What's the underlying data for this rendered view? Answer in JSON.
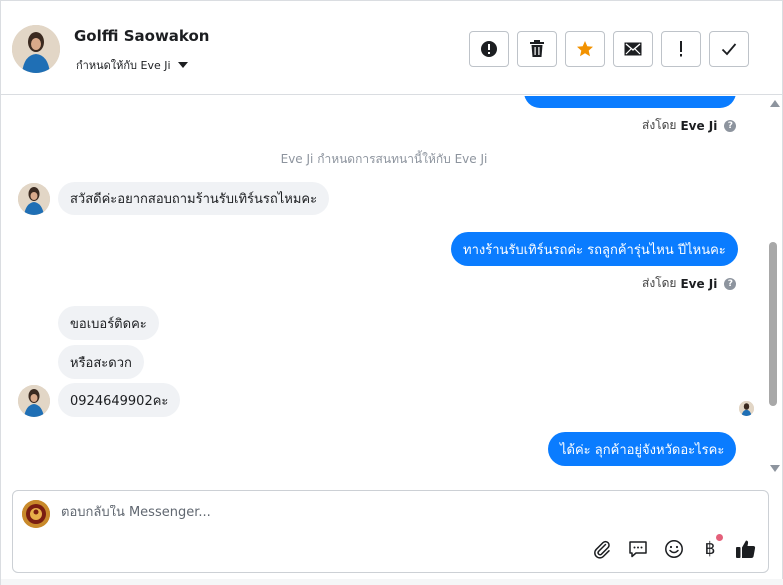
{
  "header": {
    "contact_name": "Golffi Saowakon",
    "assign_label": "กำหนดให้กับ Eve Ji",
    "actions": [
      {
        "name": "spam-button",
        "icon": "alert-circle-icon"
      },
      {
        "name": "delete-button",
        "icon": "trash-icon"
      },
      {
        "name": "star-button",
        "icon": "star-icon"
      },
      {
        "name": "mark-unread-button",
        "icon": "envelope-icon"
      },
      {
        "name": "follow-up-button",
        "icon": "exclamation-icon"
      },
      {
        "name": "mark-done-button",
        "icon": "checkmark-icon"
      }
    ],
    "star_color": "#f29200"
  },
  "conversation": {
    "sent_by_prefix": "ส่งโดย",
    "sent_by_name": "Eve Ji",
    "system_note": "Eve Ji กำหนดการสนทนานี้ให้กับ Eve Ji",
    "messages": [
      {
        "direction": "in",
        "text": "สวัสดีค่ะอยากสอบถามร้านรับเทิร์นรถไหมคะ"
      },
      {
        "direction": "out",
        "text": "ทางร้านรับเทิร์นรถค่ะ รถลูกค้ารุ่นไหน ปีไหนคะ"
      },
      {
        "direction": "in",
        "text": "ขอเบอร์ติดคะ"
      },
      {
        "direction": "in",
        "text": "หรือสะดวก"
      },
      {
        "direction": "in",
        "text": "0924649902คะ"
      },
      {
        "direction": "out",
        "text": "ได้ค่ะ ลุกค้าอยู่จังหวัดอะไรคะ"
      }
    ],
    "outgoing_color": "#0a7cff",
    "incoming_color": "#f0f2f5"
  },
  "composer": {
    "placeholder": "ตอบกลับใน Messenger...",
    "tools": [
      "paperclip-icon",
      "chat-bubble-icon",
      "smiley-icon",
      "baht-icon",
      "thumbs-up-icon"
    ],
    "baht_symbol": "฿"
  }
}
